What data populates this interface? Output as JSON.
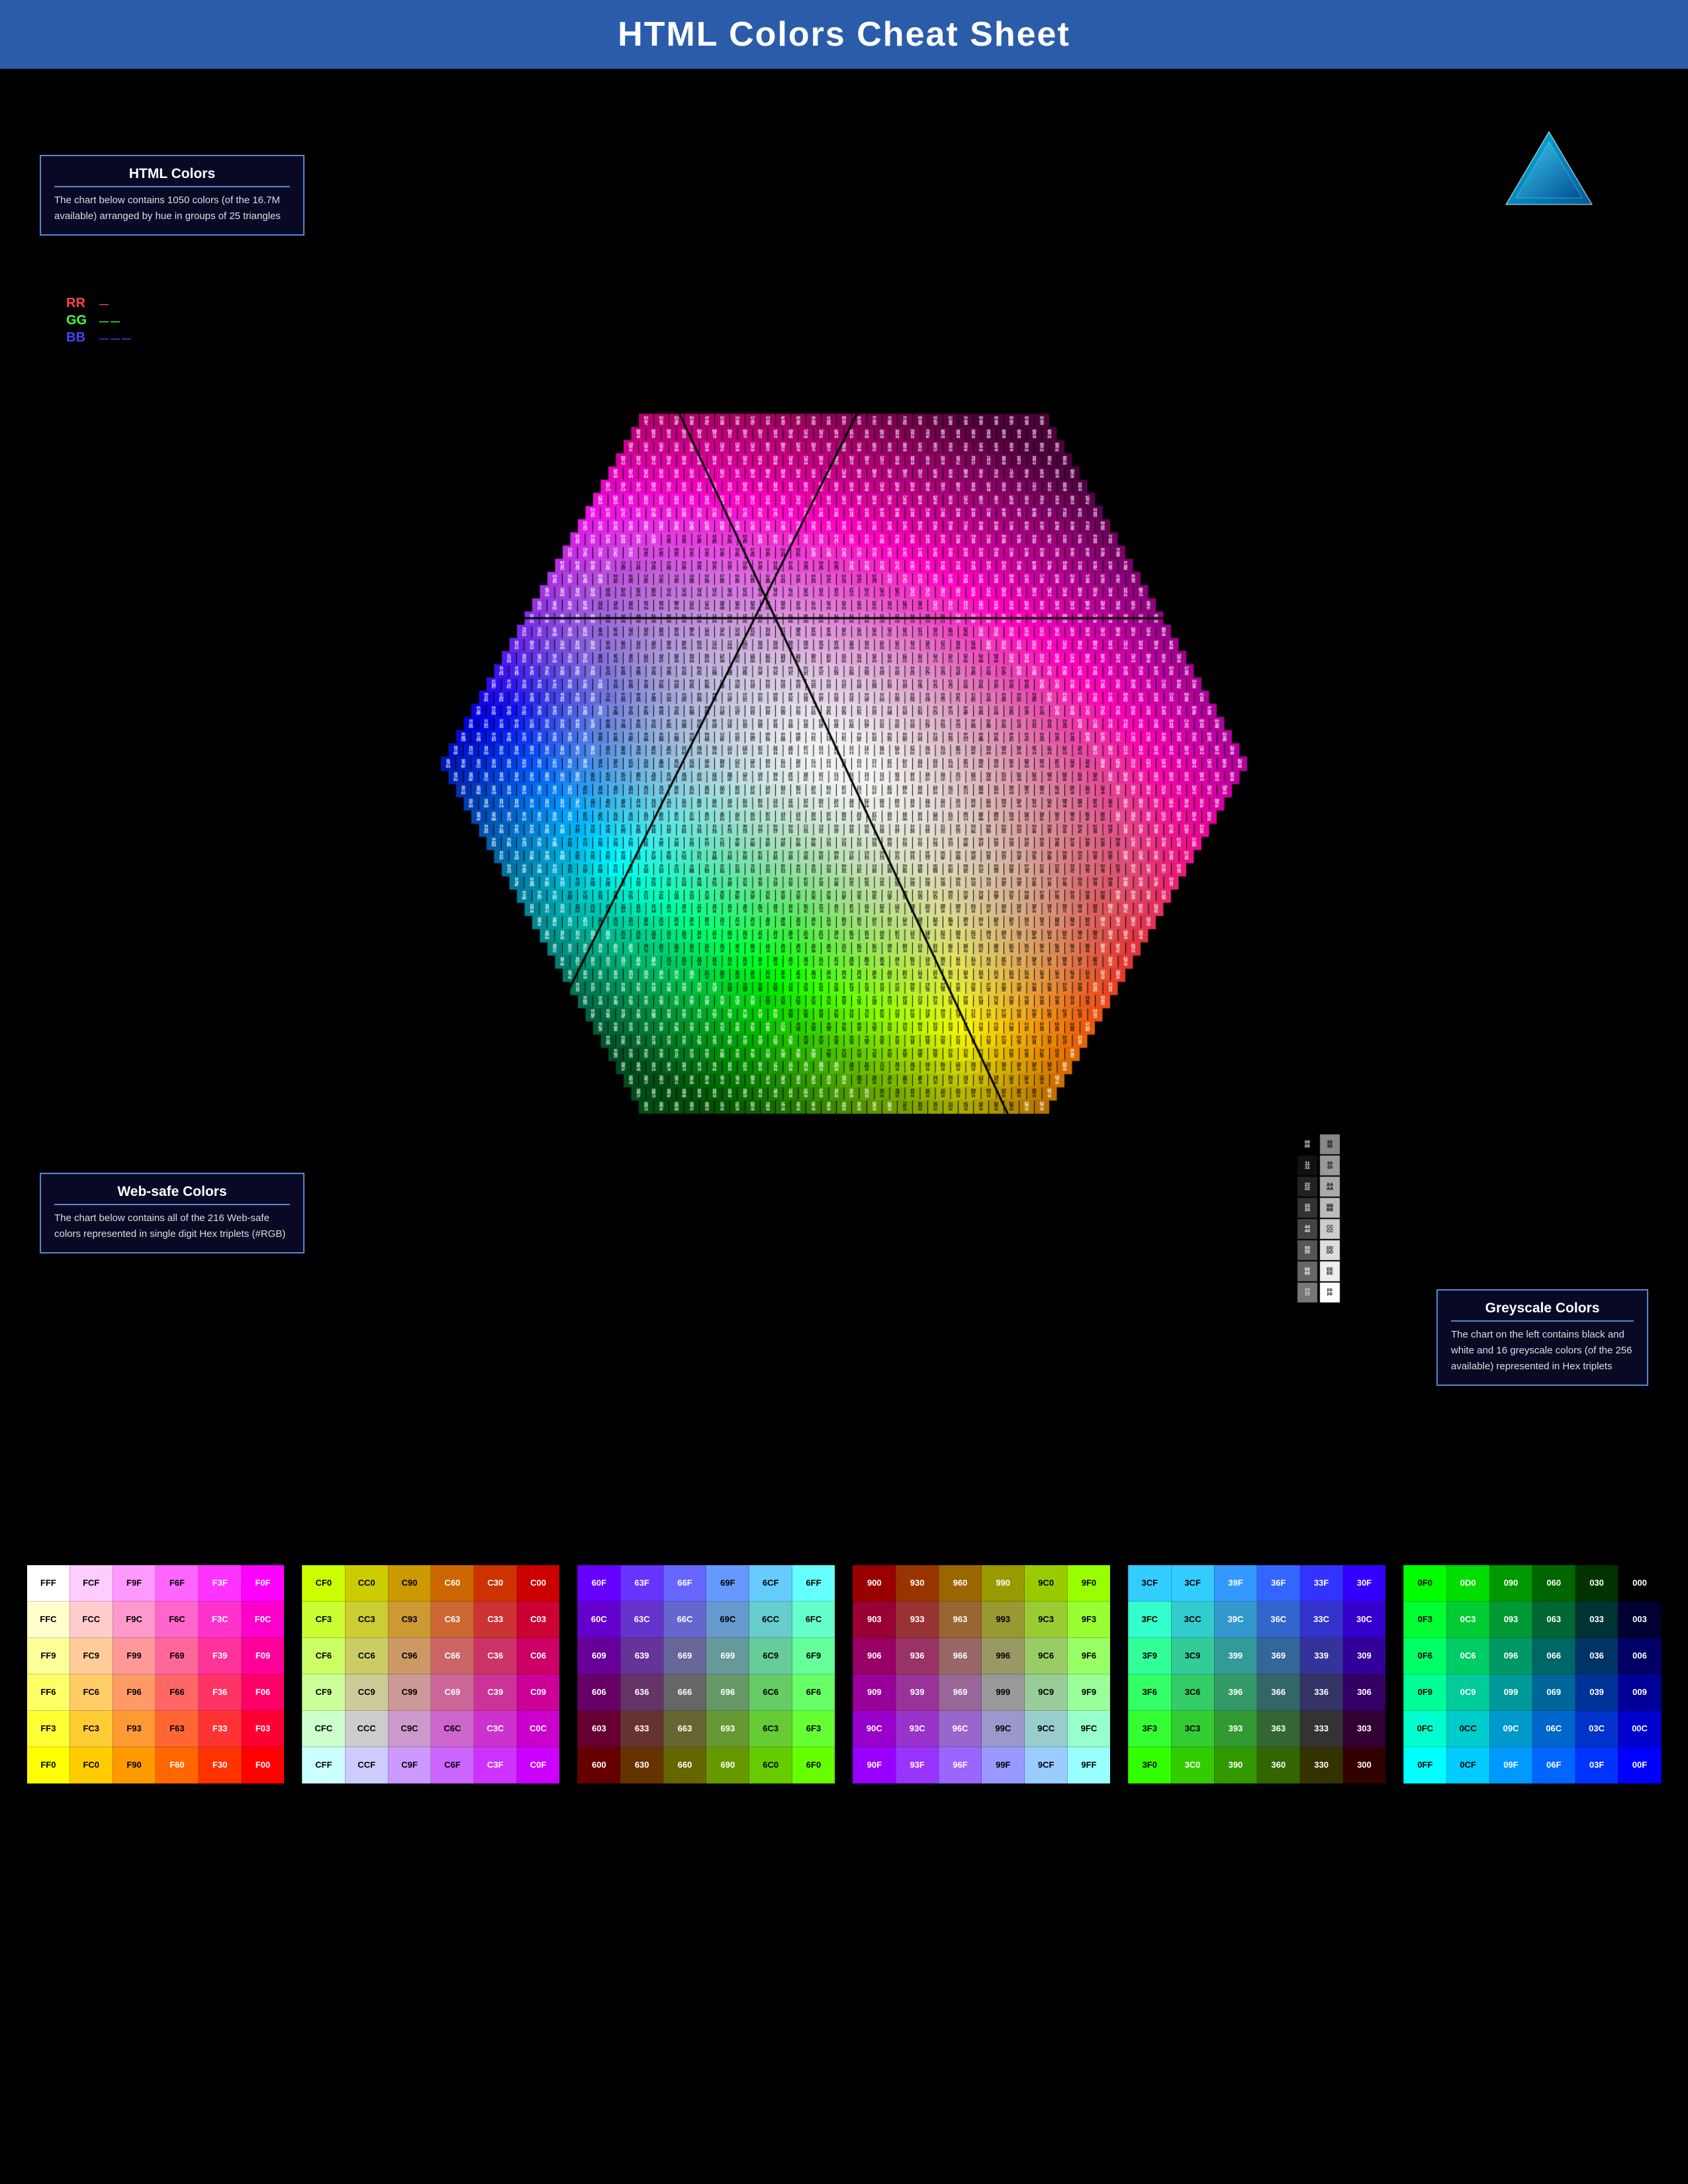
{
  "title": "HTML Colors Cheat Sheet",
  "panels": {
    "html_colors": {
      "heading": "HTML Colors",
      "text": "The chart below contains 1050 colors (of the 16.7M available) arranged by hue in groups of 25 triangles"
    },
    "websafe": {
      "heading": "Web-safe Colors",
      "text": "The chart below contains all of the 216 Web-safe colors represented in single digit Hex triplets (#RGB)"
    },
    "greyscale": {
      "heading": "Greyscale Colors",
      "text": "The chart on the left contains black and white and 16 greyscale colors (of the 256 available) represented in Hex triplets"
    }
  },
  "legend": {
    "rr": "RR",
    "gg": "GG",
    "bb": "BB",
    "rr_dots": "—",
    "gg_dots": "——",
    "bb_dots": "———"
  },
  "web_safe_table": {
    "rows": [
      [
        "FFF",
        "FCF",
        "F9F",
        "F6F",
        "F3F",
        "F0F",
        "CF0",
        "CC0",
        "C90",
        "C60",
        "C30",
        "C00",
        "60F",
        "63F",
        "66F",
        "69F",
        "6CF",
        "6FF",
        "900",
        "930",
        "960",
        "990",
        "9C0",
        "9F0",
        "3CF",
        "3CF",
        "39F",
        "36F",
        "33F",
        "30F",
        "0F0",
        "0D0",
        "090",
        "060",
        "030",
        "000"
      ],
      [
        "FFC",
        "FCC",
        "F9C",
        "F6C",
        "F3C",
        "F0C",
        "CF3",
        "CC3",
        "C93",
        "C63",
        "C33",
        "C03",
        "60C",
        "63C",
        "66C",
        "69C",
        "6CC",
        "6FC",
        "903",
        "933",
        "963",
        "993",
        "9C3",
        "9F3",
        "3FC",
        "3CC",
        "39C",
        "36C",
        "33C",
        "30C",
        "0F3",
        "0C3",
        "093",
        "063",
        "033",
        "003"
      ],
      [
        "FF9",
        "FC9",
        "F99",
        "F69",
        "F39",
        "F09",
        "CF6",
        "CC6",
        "C96",
        "C66",
        "C36",
        "C06",
        "609",
        "639",
        "669",
        "699",
        "6C9",
        "6F9",
        "906",
        "936",
        "966",
        "996",
        "9C6",
        "9F6",
        "3F9",
        "3C9",
        "399",
        "369",
        "339",
        "309",
        "0F6",
        "0C6",
        "096",
        "066",
        "036",
        "006"
      ],
      [
        "FF6",
        "FC6",
        "F96",
        "F66",
        "F36",
        "F06",
        "CF9",
        "CC9",
        "C99",
        "C69",
        "C39",
        "C09",
        "606",
        "636",
        "666",
        "696",
        "6C6",
        "6F6",
        "909",
        "939",
        "969",
        "999",
        "9C9",
        "9F9",
        "3F6",
        "3C6",
        "396",
        "366",
        "336",
        "306",
        "0F9",
        "0C9",
        "099",
        "069",
        "039",
        "009"
      ],
      [
        "FF3",
        "FC3",
        "F93",
        "F63",
        "F33",
        "F03",
        "CFC",
        "CCC",
        "C9C",
        "C6C",
        "C3C",
        "C0C",
        "603",
        "633",
        "663",
        "693",
        "6C3",
        "6F3",
        "90C",
        "93C",
        "96C",
        "99C",
        "9CC",
        "9FC",
        "3F3",
        "3C3",
        "393",
        "363",
        "333",
        "303",
        "0FC",
        "0CC",
        "09C",
        "06C",
        "03C",
        "00C"
      ],
      [
        "FF0",
        "FC0",
        "F90",
        "F60",
        "F30",
        "F00",
        "CFF",
        "CCF",
        "C9F",
        "C6F",
        "C3F",
        "C0F",
        "600",
        "630",
        "660",
        "690",
        "6C0",
        "6F0",
        "90F",
        "93F",
        "96F",
        "99F",
        "9CF",
        "9FF",
        "3F0",
        "3C0",
        "390",
        "360",
        "330",
        "300",
        "0FF",
        "0CF",
        "09F",
        "06F",
        "03F",
        "00F"
      ]
    ]
  }
}
